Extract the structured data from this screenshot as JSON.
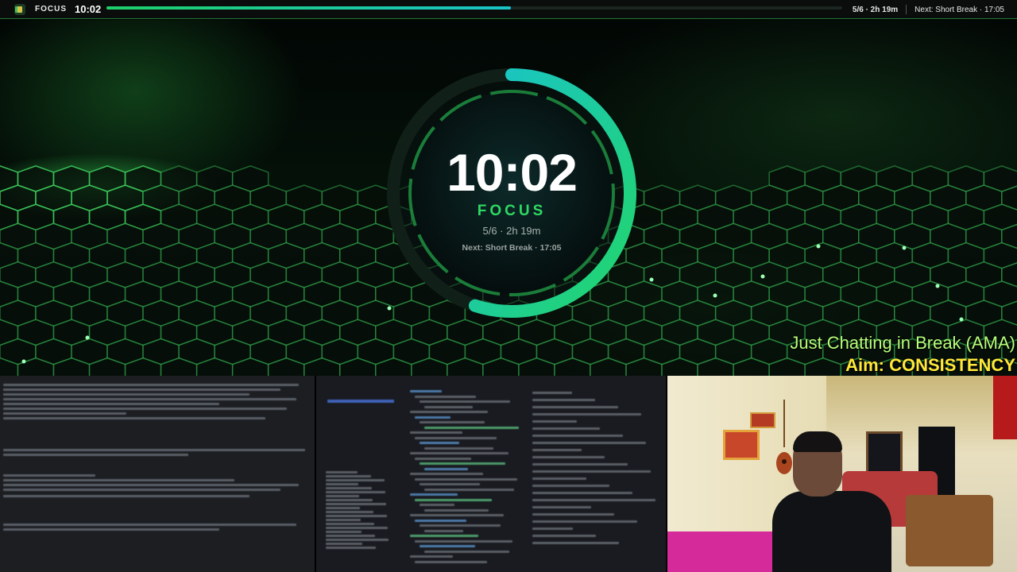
{
  "topbar": {
    "mode_label": "FOCUS",
    "time": "10:02",
    "progress_percent": 55,
    "session": "5/6 · 2h 19m",
    "next": "Next: Short Break · 17:05"
  },
  "timer": {
    "time": "10:02",
    "mode": "FOCUS",
    "session": "5/6 · 2h 19m",
    "next": "Next: Short Break · 17:05",
    "progress_percent": 55
  },
  "overlay": {
    "line1": "Just Chatting in Break (AMA)",
    "line2": "Aim: CONSISTENCY"
  },
  "colors": {
    "accent_green": "#2fd863",
    "accent_teal": "#19c4c8",
    "overlay_green": "#b8ff7a",
    "overlay_yellow": "#ffe83a"
  },
  "icons": {
    "app": "timer-app-icon"
  }
}
